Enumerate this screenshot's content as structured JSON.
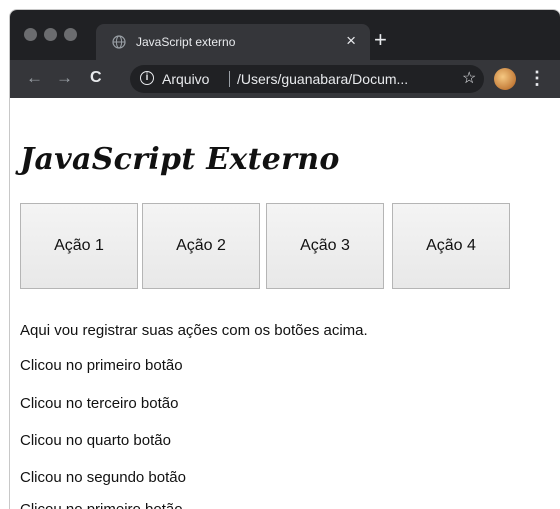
{
  "browser": {
    "tab_title": "JavaScript externo",
    "tab_close": "×",
    "new_tab": "+",
    "nav": {
      "back": "←",
      "forward": "→",
      "reload": "C"
    },
    "address": {
      "scheme_label": "Arquivo",
      "url": "/Users/guanabara/Docum...",
      "bookmark": "☆"
    },
    "menu": "⋮"
  },
  "page": {
    "heading": "JavaScript Externo",
    "buttons": [
      "Ação 1",
      "Ação 2",
      "Ação 3",
      "Ação 4"
    ],
    "intro": "Aqui vou registrar suas ações com os botões acima.",
    "log": [
      "Clicou no primeiro botão",
      "Clicou no terceiro botão",
      "Clicou no quarto botão",
      "Clicou no segundo botão",
      "Clicou no primeiro botão"
    ]
  }
}
